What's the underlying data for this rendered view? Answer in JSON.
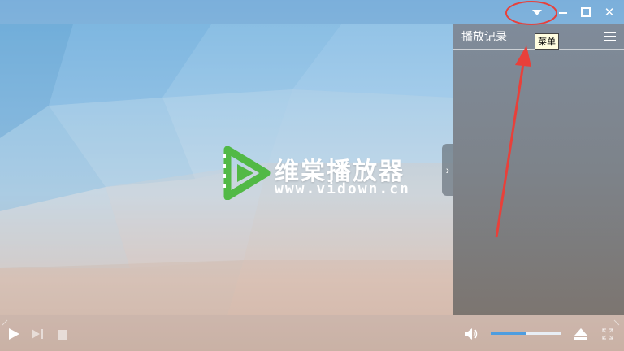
{
  "app": {
    "logo_text": "维棠播放器",
    "logo_url": "www.vidown.cn"
  },
  "titlebar": {
    "menu_tooltip": "菜单"
  },
  "panel": {
    "title": "播放记录"
  },
  "controls": {
    "volume_level": 0.5
  },
  "colors": {
    "logo_green": "#52b946",
    "volume_fill": "#4d9de0",
    "annotation_red": "#e8403a"
  },
  "annotation": {
    "circle_color": "#e8403a",
    "arrow_color": "#e8403a"
  }
}
